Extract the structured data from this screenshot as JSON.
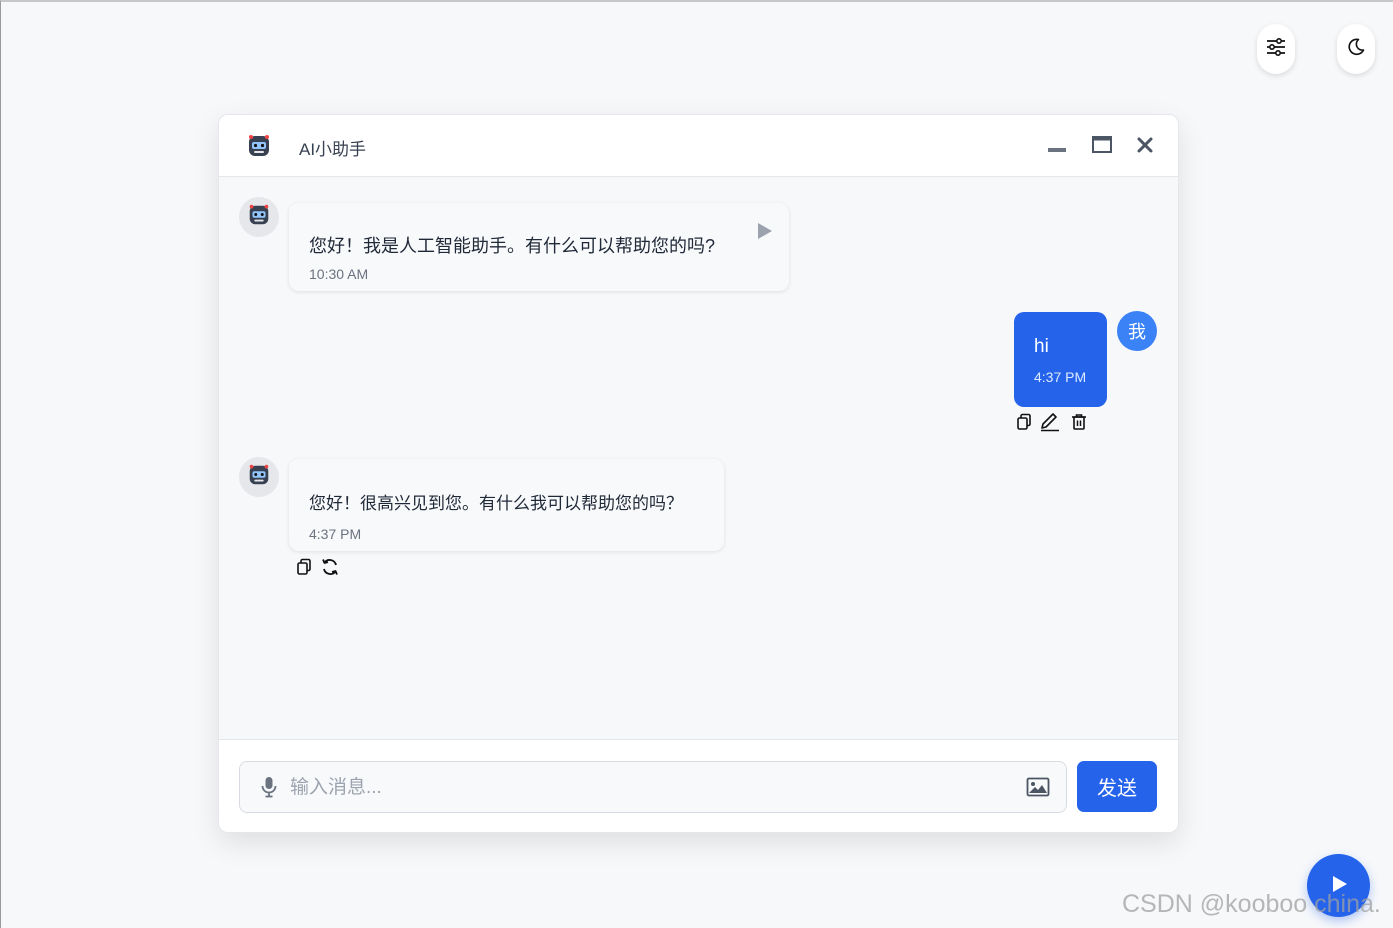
{
  "top_controls": {
    "settings_icon": "sliders-icon",
    "theme_icon": "moon-icon"
  },
  "header": {
    "title": "AI小助手",
    "avatar_icon": "robot-icon",
    "controls": [
      "minimize-icon",
      "maximize-icon",
      "close-icon"
    ]
  },
  "messages": [
    {
      "role": "assistant",
      "text": "您好！我是人工智能助手。有什么可以帮助您的吗?",
      "time": "10:30 AM",
      "icons": [
        "play-icon"
      ]
    },
    {
      "role": "user",
      "avatar_label": "我",
      "text": "hi",
      "time": "4:37 PM",
      "actions": [
        "copy-icon",
        "edit-icon",
        "delete-icon"
      ]
    },
    {
      "role": "assistant",
      "text": "您好！很高兴见到您。有什么我可以帮助您的吗？",
      "time": "4:37 PM",
      "actions": [
        "copy-icon",
        "refresh-icon"
      ]
    }
  ],
  "composer": {
    "placeholder": "输入消息...",
    "value": "",
    "send_label": "发送",
    "mic_icon": "microphone-icon",
    "image_icon": "image-icon"
  },
  "watermark": "CSDN @kooboo china.",
  "colors": {
    "accent": "#2563eb",
    "user_avatar": "#3b82f6",
    "background": "#f7f8fa"
  }
}
